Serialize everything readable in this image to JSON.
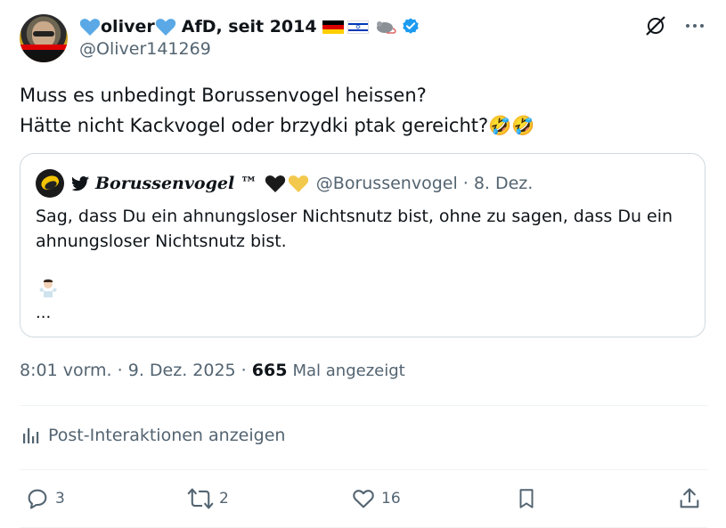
{
  "author": {
    "name": "oliver",
    "name_suffix": "AfD, seit 2014",
    "handle": "@Oliver141269"
  },
  "tweet": {
    "line1": "Muss es unbedingt Borussenvogel heissen?",
    "line2": "Hätte nicht Kackvogel oder brzydki ptak gereicht?🤣🤣"
  },
  "quote": {
    "name": "𝑩𝒐𝒓𝒖𝒔𝒔𝒆𝒏𝒗𝒐𝒈𝒆𝒍 ™",
    "handle": "@Borussenvogel",
    "date": "· 8. Dez.",
    "text": "Sag, dass Du ein ahnungsloser Nichtsnutz bist, ohne zu sagen, dass Du ein ahnungsloser Nichtsnutz bist.",
    "ellipsis": "..."
  },
  "meta": {
    "time": "8:01 vorm.",
    "date": "· 9. Dez. 2025 ·",
    "views": "665",
    "views_label": "Mal angezeigt"
  },
  "insights_label": "Post-Interaktionen anzeigen",
  "actions": {
    "replies": "3",
    "reposts": "2",
    "likes": "16"
  },
  "colors": {
    "verified": "#1d9bf0",
    "heart_blue": "#5aa9e6",
    "heart_yellow": "#f2c94c",
    "heart_black": "#1a1a1a",
    "secondary_text": "#536471"
  },
  "icons": [
    "heart-blue-icon",
    "flag-germany-icon",
    "flag-israel-icon",
    "rat-icon",
    "verified-badge-icon",
    "grok-icon",
    "more-icon",
    "bird-icon",
    "heart-black-icon",
    "heart-yellow-icon",
    "shrug-emoji-icon",
    "analytics-icon",
    "reply-icon",
    "repost-icon",
    "like-icon",
    "bookmark-icon",
    "share-icon"
  ]
}
